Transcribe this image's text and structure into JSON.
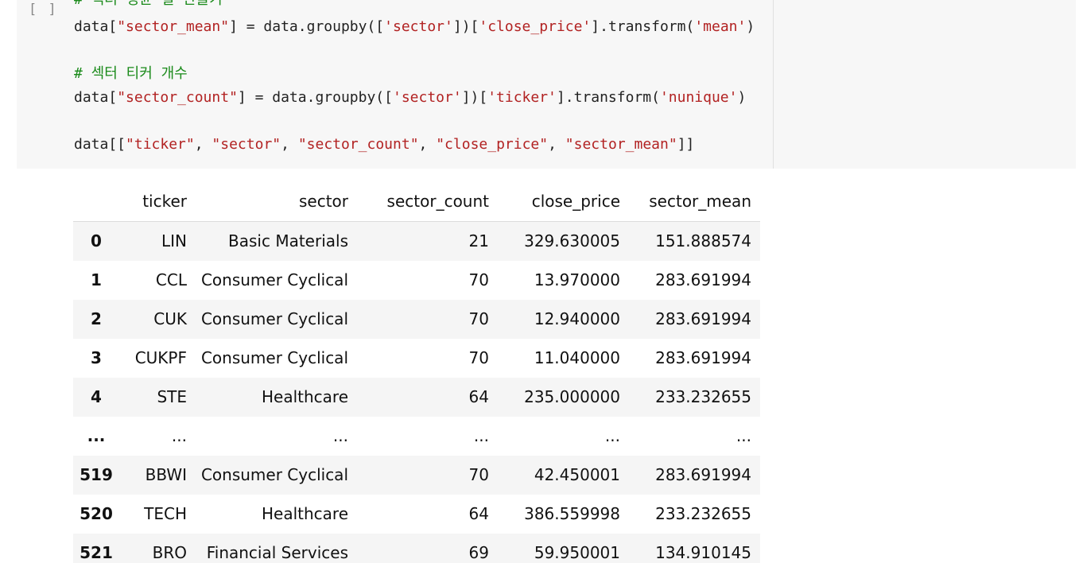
{
  "cell": {
    "run_button": "[ ]",
    "code_lines": [
      [
        {
          "t": "# 섹터 평균 열 만들기",
          "c": "cmt"
        }
      ],
      [
        {
          "t": "data[",
          "c": ""
        },
        {
          "t": "\"sector_mean\"",
          "c": "str"
        },
        {
          "t": "] = data.groupby([",
          "c": ""
        },
        {
          "t": "'sector'",
          "c": "str"
        },
        {
          "t": "])[",
          "c": ""
        },
        {
          "t": "'close_price'",
          "c": "str"
        },
        {
          "t": "].transform(",
          "c": ""
        },
        {
          "t": "'mean'",
          "c": "str"
        },
        {
          "t": ")",
          "c": ""
        }
      ],
      [],
      [
        {
          "t": "# 섹터 티커 개수",
          "c": "cmt"
        }
      ],
      [
        {
          "t": "data[",
          "c": ""
        },
        {
          "t": "\"sector_count\"",
          "c": "str"
        },
        {
          "t": "] = data.groupby([",
          "c": ""
        },
        {
          "t": "'sector'",
          "c": "str"
        },
        {
          "t": "])[",
          "c": ""
        },
        {
          "t": "'ticker'",
          "c": "str"
        },
        {
          "t": "].transform(",
          "c": ""
        },
        {
          "t": "'nunique'",
          "c": "str"
        },
        {
          "t": ")",
          "c": ""
        }
      ],
      [],
      [
        {
          "t": "data[[",
          "c": ""
        },
        {
          "t": "\"ticker\"",
          "c": "str"
        },
        {
          "t": ", ",
          "c": ""
        },
        {
          "t": "\"sector\"",
          "c": "str"
        },
        {
          "t": ", ",
          "c": ""
        },
        {
          "t": "\"sector_count\"",
          "c": "str"
        },
        {
          "t": ", ",
          "c": ""
        },
        {
          "t": "\"close_price\"",
          "c": "str"
        },
        {
          "t": ", ",
          "c": ""
        },
        {
          "t": "\"sector_mean\"",
          "c": "str"
        },
        {
          "t": "]]",
          "c": ""
        }
      ]
    ]
  },
  "table": {
    "columns": [
      "",
      "ticker",
      "sector",
      "sector_count",
      "close_price",
      "sector_mean"
    ],
    "rows": [
      [
        "0",
        "LIN",
        "Basic Materials",
        "21",
        "329.630005",
        "151.888574"
      ],
      [
        "1",
        "CCL",
        "Consumer Cyclical",
        "70",
        "13.970000",
        "283.691994"
      ],
      [
        "2",
        "CUK",
        "Consumer Cyclical",
        "70",
        "12.940000",
        "283.691994"
      ],
      [
        "3",
        "CUKPF",
        "Consumer Cyclical",
        "70",
        "11.040000",
        "283.691994"
      ],
      [
        "4",
        "STE",
        "Healthcare",
        "64",
        "235.000000",
        "233.232655"
      ],
      [
        "...",
        "...",
        "...",
        "...",
        "...",
        "..."
      ],
      [
        "519",
        "BBWI",
        "Consumer Cyclical",
        "70",
        "42.450001",
        "283.691994"
      ],
      [
        "520",
        "TECH",
        "Healthcare",
        "64",
        "386.559998",
        "233.232655"
      ],
      [
        "521",
        "BRO",
        "Financial Services",
        "69",
        "59.950001",
        "134.910145"
      ]
    ]
  }
}
